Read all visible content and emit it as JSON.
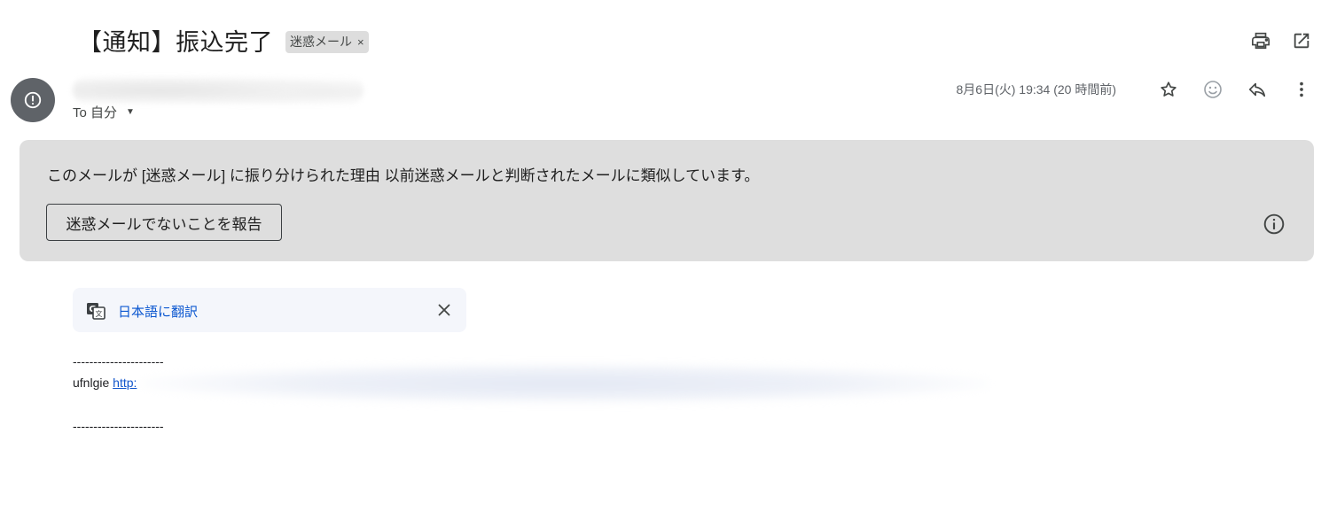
{
  "email": {
    "subject": "【通知】振込完了",
    "label_chip": {
      "text": "迷惑メール",
      "remove": "×"
    },
    "recipient": "To 自分",
    "timestamp": "8月6日(火) 19:34 (20 時間前)"
  },
  "icons": {
    "print": "printer-icon",
    "open_new_window": "open-in-new-window-icon",
    "star": "star-icon",
    "emoji": "emoji-reaction-icon",
    "reply": "reply-icon",
    "more": "more-vert-icon",
    "spam_avatar": "spam-warning-icon",
    "info": "info-icon",
    "translate": "translate-icon",
    "close": "close-icon"
  },
  "spam_banner": {
    "reason": "このメールが [迷惑メール] に振り分けられた理由 以前迷惑メールと判断されたメールに類似しています。",
    "report_button": "迷惑メールでないことを報告"
  },
  "translate": {
    "link": "日本語に翻訳"
  },
  "body": {
    "separator_top": "----------------------",
    "line_prefix": "ufnlgie ",
    "link_visible": "http:",
    "separator_bottom": "----------------------"
  },
  "colors": {
    "banner_bg": "#dedede",
    "avatar_bg": "#5f6368",
    "link": "#1155cc",
    "translate_link": "#0b57d0",
    "chip_bg": "#dddddd"
  }
}
